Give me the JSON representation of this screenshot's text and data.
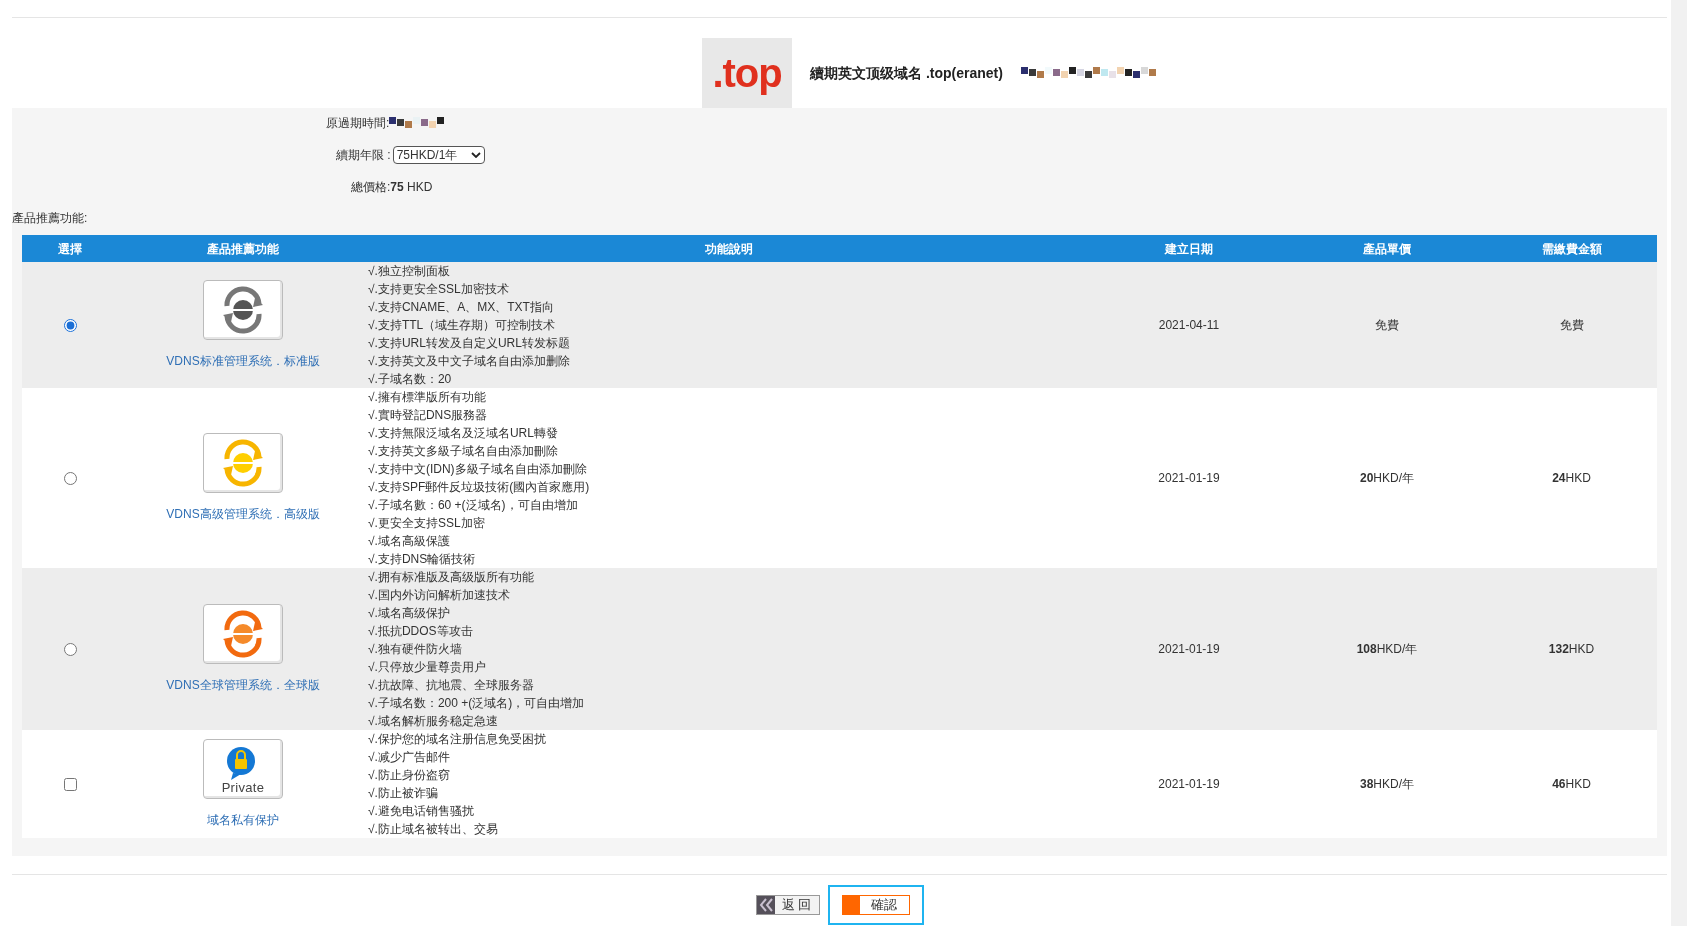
{
  "header": {
    "logo_text": ".top",
    "title": "續期英文顶级域名 .top(eranet)"
  },
  "renewal": {
    "expiry_label": "原過期時間:",
    "period_label": "續期年限 :",
    "period_value": "75HKD/1年",
    "total": "總價格:**75** HKD"
  },
  "section_label": "產品推薦功能:",
  "table": {
    "columns": [
      "選擇",
      "產品推薦功能",
      "功能說明",
      "建立日期",
      "產品單價",
      "需繳費金額"
    ],
    "rows": [
      {
        "kind": "standard",
        "selected": true,
        "name": "VDNS标准管理系统．标准版",
        "features": [
          "√.独立控制面板",
          "√.支持更安全SSL加密技术",
          "√.支持CNAME、A、MX、TXT指向",
          "√.支持TTL（域生存期）可控制技术",
          "√.支持URL转发及自定义URL转发标题",
          "√.支持英文及中文子域名自由添加删除",
          "√.子域名数：20"
        ],
        "date": "2021-04-11",
        "price": "免費",
        "amount": "免費"
      },
      {
        "kind": "advanced",
        "selected": false,
        "name": "VDNS高级管理系统．高级版",
        "features": [
          "√.擁有標準版所有功能",
          "√.實時登記DNS服務器",
          "√.支持無限泛域名及泛域名URL轉發",
          "√.支持英文多級子域名自由添加刪除",
          "√.支持中文(IDN)多級子域名自由添加刪除",
          "√.支持SPF郵件反垃圾技術(國內首家應用)",
          "√.子域名數：60 +(泛域名)，可自由增加",
          "√.更安全支持SSL加密",
          "√.域名高級保護",
          "√.支持DNS輪循技術"
        ],
        "date": "2021-01-19",
        "price": "**20**HKD/年",
        "amount": "**24**HKD"
      },
      {
        "kind": "global",
        "selected": false,
        "name": "VDNS全球管理系统．全球版",
        "features": [
          "√.拥有标准版及高级版所有功能",
          "√.国内外访问解析加速技术",
          "√.域名高级保护",
          "√.抵抗DDOS等攻击",
          "√.独有硬件防火墙",
          "√.只停放少量尊贵用户",
          "√.抗故障、抗地震、全球服务器",
          "√.子域名数：200 +(泛域名)，可自由增加",
          "√.域名解析服务稳定急速"
        ],
        "date": "2021-01-19",
        "price": "**108**HKD/年",
        "amount": "**132**HKD"
      },
      {
        "kind": "private",
        "selected": false,
        "icon_label": "Private",
        "name": "域名私有保护",
        "features": [
          "√.保护您的域名注册信息免受困扰",
          "√.减少广告邮件",
          "√.防止身份盗窃",
          "√.防止被诈骗",
          "√.避免电话销售骚扰",
          "√.防止域名被转出、交易"
        ],
        "date": "2021-01-19",
        "price": "**38**HKD/年",
        "amount": "**46**HKD"
      }
    ]
  },
  "buttons": [
    {
      "kind": "back",
      "label": "返 回"
    },
    {
      "kind": "confirm",
      "label": "確認"
    }
  ]
}
